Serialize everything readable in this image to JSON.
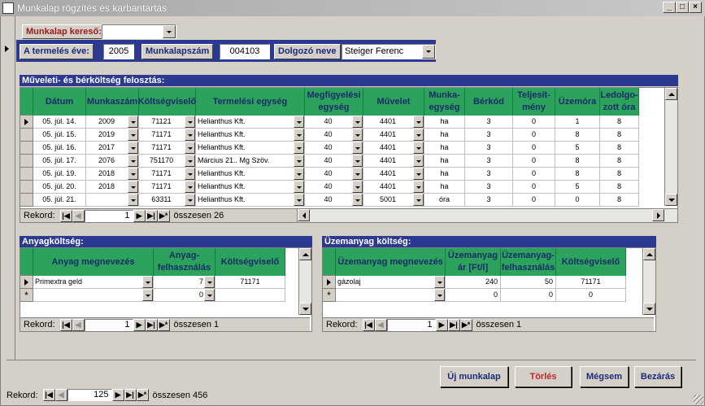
{
  "window": {
    "title": "Munkalap rögzítés és karbantartás",
    "min": "_",
    "max": "□",
    "close": "×"
  },
  "search": {
    "label": "Munkalap kereső:",
    "value": ""
  },
  "header": {
    "year_label": "A termelés éve:",
    "year_value": "2005",
    "sheet_label": "Munkalapszám",
    "sheet_value": "004103",
    "worker_label": "Dolgozó neve",
    "worker_value": "Steiger Ferenc"
  },
  "main_section": {
    "title": "Műveleti-  és bérköltség felosztás:",
    "columns": [
      "Dátum",
      "Munkaszám",
      "Költségviselő",
      "Termelési egység",
      "Megfigyelési egység",
      "Művelet",
      "Munka-egység",
      "Bérkód",
      "Teljesít-mény",
      "Üzemóra",
      "Ledolgo-zott óra"
    ],
    "rows": [
      [
        "05. júl. 14.",
        "2009",
        "71121",
        "Helianthus Kft.",
        "40",
        "4401",
        "ha",
        "3",
        "0",
        "1",
        "8"
      ],
      [
        "05. júl. 15.",
        "2019",
        "71171",
        "Helianthus Kft.",
        "40",
        "4401",
        "ha",
        "3",
        "0",
        "8",
        "8"
      ],
      [
        "05. júl. 16.",
        "2017",
        "71171",
        "Helianthus Kft.",
        "40",
        "4401",
        "ha",
        "3",
        "0",
        "5",
        "8"
      ],
      [
        "05. júl. 17.",
        "2076",
        "751170",
        "Március 21.. Mg Szöv.",
        "40",
        "4401",
        "ha",
        "3",
        "0",
        "8",
        "8"
      ],
      [
        "05. júl. 19.",
        "2018",
        "71171",
        "Helianthus Kft.",
        "40",
        "4401",
        "ha",
        "3",
        "0",
        "8",
        "8"
      ],
      [
        "05. júl. 20.",
        "2018",
        "71171",
        "Helianthus Kft.",
        "40",
        "4401",
        "ha",
        "3",
        "0",
        "5",
        "8"
      ],
      [
        "05. júl. 21.",
        "",
        "63311",
        "Helianthus Kft.",
        "40",
        "5001",
        "óra",
        "3",
        "0",
        "0",
        "8"
      ]
    ],
    "nav": {
      "label": "Rekord:",
      "current": "1",
      "total": "összesen 26"
    }
  },
  "material_section": {
    "title": "Anyagköltség:",
    "columns": [
      "Anyag megnevezés",
      "Anyag-felhasználás",
      "Költségviselő"
    ],
    "rows": [
      [
        "Primextra geld",
        "7",
        "71171"
      ]
    ],
    "new_row": [
      "",
      "0",
      ""
    ],
    "nav": {
      "label": "Rekord:",
      "current": "1",
      "total": "összesen 1"
    }
  },
  "fuel_section": {
    "title": "Üzemanyag költség:",
    "columns": [
      "Üzemanyag megnevezés",
      "Üzemanyag ár [Ft/l]",
      "Üzemanyag-felhasználás",
      "Költségviselő"
    ],
    "rows": [
      [
        "gázolaj",
        "240",
        "50",
        "71171"
      ]
    ],
    "new_row": [
      "",
      "0",
      "0",
      "0"
    ],
    "nav": {
      "label": "Rekord:",
      "current": "1",
      "total": "összesen 1"
    }
  },
  "buttons": {
    "new": "Új munkalap",
    "delete": "Törlés",
    "cancel": "Mégsem",
    "close": "Bezárás"
  },
  "bottom_nav": {
    "label": "Rekord:",
    "current": "125",
    "total": "összesen 456"
  },
  "nav_glyphs": {
    "first": "|◀",
    "prev": "◀",
    "next": "▶",
    "last": "▶|",
    "new": "▶*"
  },
  "colors": {
    "header_green": "#2ba35c",
    "band_navy": "#2b3990",
    "delete_red": "#c0282d"
  }
}
